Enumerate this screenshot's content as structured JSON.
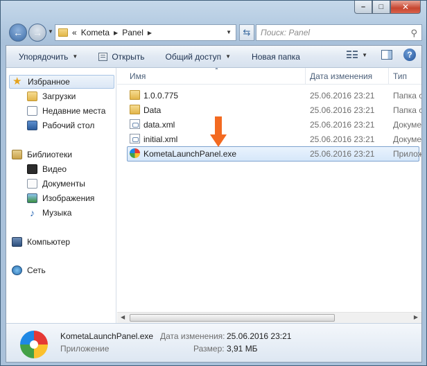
{
  "caption": {
    "minimize": "–",
    "maximize": "□",
    "close": "✕"
  },
  "address": {
    "overflow": "«",
    "crumbs": [
      "Kometa",
      "Panel"
    ]
  },
  "search": {
    "placeholder": "Поиск: Panel"
  },
  "toolbar": {
    "organize": "Упорядочить",
    "open": "Открыть",
    "share": "Общий доступ",
    "new_folder": "Новая папка",
    "help": "?"
  },
  "navpane": {
    "favorites": "Избранное",
    "downloads": "Загрузки",
    "recent": "Недавние места",
    "desktop": "Рабочий стол",
    "libraries": "Библиотеки",
    "video": "Видео",
    "documents": "Документы",
    "pictures": "Изображения",
    "music": "Музыка",
    "computer": "Компьютер",
    "network": "Сеть"
  },
  "columns": {
    "name": "Имя",
    "date": "Дата изменения",
    "type": "Тип"
  },
  "files": [
    {
      "name": "1.0.0.775",
      "date": "25.06.2016 23:21",
      "type": "Папка с файлами",
      "icon": "folder"
    },
    {
      "name": "Data",
      "date": "25.06.2016 23:21",
      "type": "Папка с файлами",
      "icon": "folder"
    },
    {
      "name": "data.xml",
      "date": "25.06.2016 23:21",
      "type": "Документ XML",
      "icon": "xml"
    },
    {
      "name": "initial.xml",
      "date": "25.06.2016 23:21",
      "type": "Документ XML",
      "icon": "xml"
    },
    {
      "name": "KometaLaunchPanel.exe",
      "date": "25.06.2016 23:21",
      "type": "Приложение",
      "icon": "exe"
    }
  ],
  "details": {
    "name": "KometaLaunchPanel.exe",
    "type": "Приложение",
    "modified_label": "Дата изменения:",
    "modified_value": "25.06.2016 23:21",
    "size_label": "Размер:",
    "size_value": "3,91 МБ"
  },
  "colors": {
    "arrow": "#f36a21",
    "selection": "#d6e7fa"
  }
}
